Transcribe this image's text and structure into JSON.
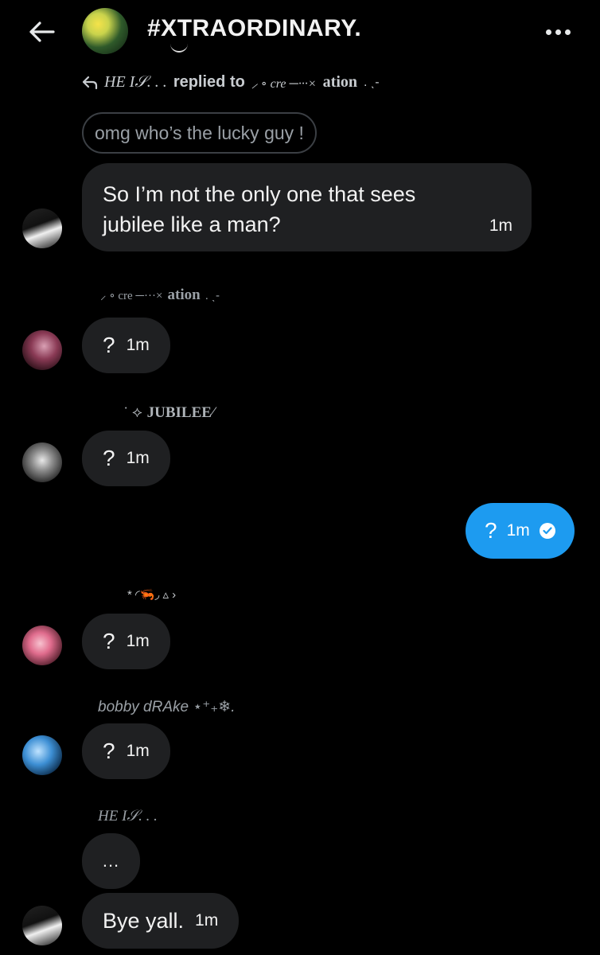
{
  "header": {
    "title": "#XTRAORDINARY.",
    "back_icon": "arrow-left-icon",
    "more_icon": "more-horizontal-icon"
  },
  "reply": {
    "icon": "reply-icon",
    "from": "HE I𝒮. . .",
    "replied_to_label": "replied to",
    "to_prefix": "⸝ ∘ cre ─···×",
    "to_name": "ation",
    "to_suffix": ". ˎ-",
    "quoted_text": "omg who’s the lucky guy !"
  },
  "messages": [
    {
      "line1": "So I’m not the only one that sees",
      "line2": "jubilee like a man?",
      "time": "1m"
    },
    {
      "sender_prefix": "⸝ ∘ cre ─···×",
      "sender_name": "ation",
      "sender_suffix": ". ˎ-",
      "text": "?",
      "time": "1m"
    },
    {
      "sender_prefix": "˙ ⟡",
      "sender_name": "JUBILEE⁄",
      "text": "?",
      "time": "1m"
    },
    {
      "text": "?",
      "time": "1m",
      "verified_icon": "check-circle-icon"
    },
    {
      "sender": "*  ◜🦐◞   ▵ ›",
      "text": "?",
      "time": "1m"
    },
    {
      "sender": "bobby dRAke ⋆⁺₊❄.",
      "text": "?",
      "time": "1m"
    },
    {
      "sender": "HE I𝒮. . .",
      "text": "...",
      "text2": "Bye yall.",
      "time": "1m"
    }
  ],
  "colors": {
    "background": "#000000",
    "bubble": "#1f2022",
    "own_bubble": "#1d9bf0"
  }
}
